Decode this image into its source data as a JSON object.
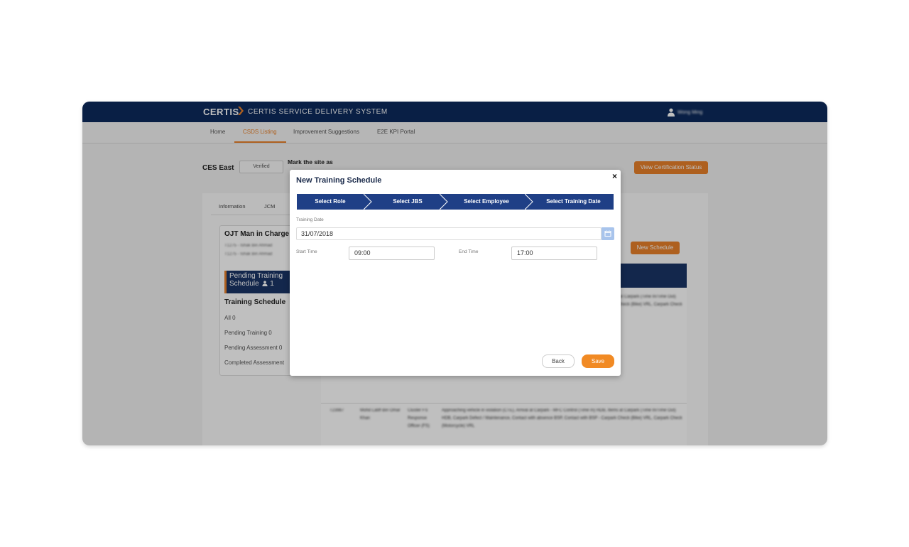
{
  "header": {
    "logo": "CERTIS",
    "system_title": "CERTIS SERVICE DELIVERY SYSTEM",
    "user_name": "Wong Ming",
    "brand_color": "#0d2a5c",
    "accent_color": "#e8812a"
  },
  "nav": {
    "items": [
      {
        "label": "Home"
      },
      {
        "label": "CSDS Listing"
      },
      {
        "label": "Improvement Suggestions"
      },
      {
        "label": "E2E KPI Portal"
      }
    ],
    "active": "CSDS Listing"
  },
  "page": {
    "site_name": "CES East",
    "verified_label": "Verified",
    "mark_site_label": "Mark the site as",
    "view_cert_button": "View Certification Status",
    "tabs": [
      {
        "label": "Information"
      },
      {
        "label": "JCM"
      }
    ],
    "card": {
      "title": "OJT Man in Charge",
      "line1": "T1275 - Ishak Bin Ahmad",
      "line2": "T1275 - Ishak Bin Ahmad",
      "pending_line1": "Pending Training",
      "pending_line2": "Schedule",
      "pending_count": "1",
      "training_schedule_title": "Training Schedule",
      "stats": [
        "All 0",
        "Pending Training 0",
        "Pending Assessment 0",
        "Completed Assessment"
      ]
    },
    "new_schedule_button": "New Schedule",
    "table_row": {
      "id": "T23987",
      "name": "Mohd Latiff Bin Omar Khan",
      "role": "Cluster FS Response Officer (FS)",
      "desc": "Approaching vehicle in violation (CTE), Arrival at Carpark - MFC Control (Time In) HDB, Items at Carpark (Time In/Time Out) HDB, Carpark Defect / Maintenance, Contact with absence BSP, Contact with BSP - Carpark Check (Bike) VRL, Carpark Check (Motorcycle) VRL"
    }
  },
  "modal": {
    "title": "New Training Schedule",
    "close_label": "×",
    "steps": [
      {
        "label": "Select Role"
      },
      {
        "label": "Select JBS"
      },
      {
        "label": "Select Employee"
      },
      {
        "label": "Select Training Date"
      }
    ],
    "training_date_label": "Training Date",
    "training_date_value": "31/07/2018",
    "start_time_label": "Start Time",
    "start_time_value": "09:00",
    "end_time_label": "End Time",
    "end_time_value": "17:00",
    "back_button": "Back",
    "save_button": "Save",
    "step_color": "#1f3f86",
    "save_color": "#f18a24"
  }
}
